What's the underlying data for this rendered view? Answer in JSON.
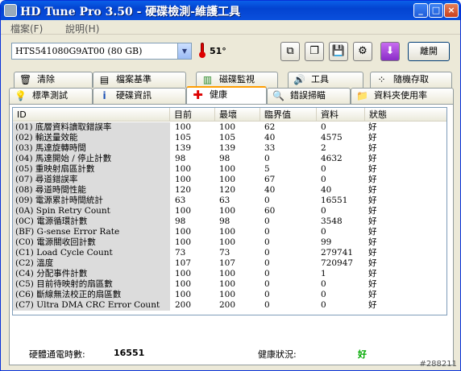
{
  "window": {
    "title": "HD Tune Pro 3.50 - 硬碟檢測-維護工具",
    "minimize": "_",
    "maximize": "□",
    "close": "×"
  },
  "menu": {
    "items": [
      "檔案(F)",
      "說明(H)"
    ]
  },
  "toolbar": {
    "drive": "HTS541080G9AT00 (80 GB)",
    "temperature": "51°",
    "exit_label": "離開"
  },
  "tabs": {
    "row1": [
      "清除",
      "檔案基準",
      "磁碟監視",
      "工具",
      "隨機存取"
    ],
    "row2": [
      "標準測試",
      "硬碟資訊",
      "健康",
      "錯誤掃瞄",
      "資料夾使用率"
    ]
  },
  "table": {
    "headers": [
      "ID",
      "目前",
      "最壞",
      "臨界值",
      "資料",
      "狀態"
    ],
    "rows": [
      [
        "(01) 底層資料讀取錯誤率",
        "100",
        "100",
        "62",
        "0",
        "好"
      ],
      [
        "(02) 輸送量效能",
        "105",
        "105",
        "40",
        "4575",
        "好"
      ],
      [
        "(03) 馬達旋轉時間",
        "139",
        "139",
        "33",
        "2",
        "好"
      ],
      [
        "(04) 馬達開始 / 停止計數",
        "98",
        "98",
        "0",
        "4632",
        "好"
      ],
      [
        "(05) 重映射扇區計數",
        "100",
        "100",
        "5",
        "0",
        "好"
      ],
      [
        "(07) 尋道錯誤率",
        "100",
        "100",
        "67",
        "0",
        "好"
      ],
      [
        "(08) 尋道時間性能",
        "120",
        "120",
        "40",
        "40",
        "好"
      ],
      [
        "(09) 電源累計時間統計",
        "63",
        "63",
        "0",
        "16551",
        "好"
      ],
      [
        "(0A) Spin Retry Count",
        "100",
        "100",
        "60",
        "0",
        "好"
      ],
      [
        "(0C) 電源循環計數",
        "98",
        "98",
        "0",
        "3548",
        "好"
      ],
      [
        "(BF) G-sense Error Rate",
        "100",
        "100",
        "0",
        "0",
        "好"
      ],
      [
        "(C0) 電源關收回計數",
        "100",
        "100",
        "0",
        "99",
        "好"
      ],
      [
        "(C1) Load Cycle Count",
        "73",
        "73",
        "0",
        "279741",
        "好"
      ],
      [
        "(C2) 溫度",
        "107",
        "107",
        "0",
        "720947",
        "好"
      ],
      [
        "(C4) 分配事件計數",
        "100",
        "100",
        "0",
        "1",
        "好"
      ],
      [
        "(C5) 目前待映射的扇區數",
        "100",
        "100",
        "0",
        "0",
        "好"
      ],
      [
        "(C6) 斷線無法校正的扇區數",
        "100",
        "100",
        "0",
        "0",
        "好"
      ],
      [
        "(C7) Ultra DMA CRC Error Count",
        "200",
        "200",
        "0",
        "0",
        "好"
      ]
    ]
  },
  "footer": {
    "power_label": "硬體通電時數:",
    "power_value": "16551",
    "health_label": "健康狀況:",
    "health_value": "好"
  },
  "watermark": "#288211",
  "colors": {
    "health_good": "#00aa00",
    "titlebar": "#0a5fe8"
  }
}
